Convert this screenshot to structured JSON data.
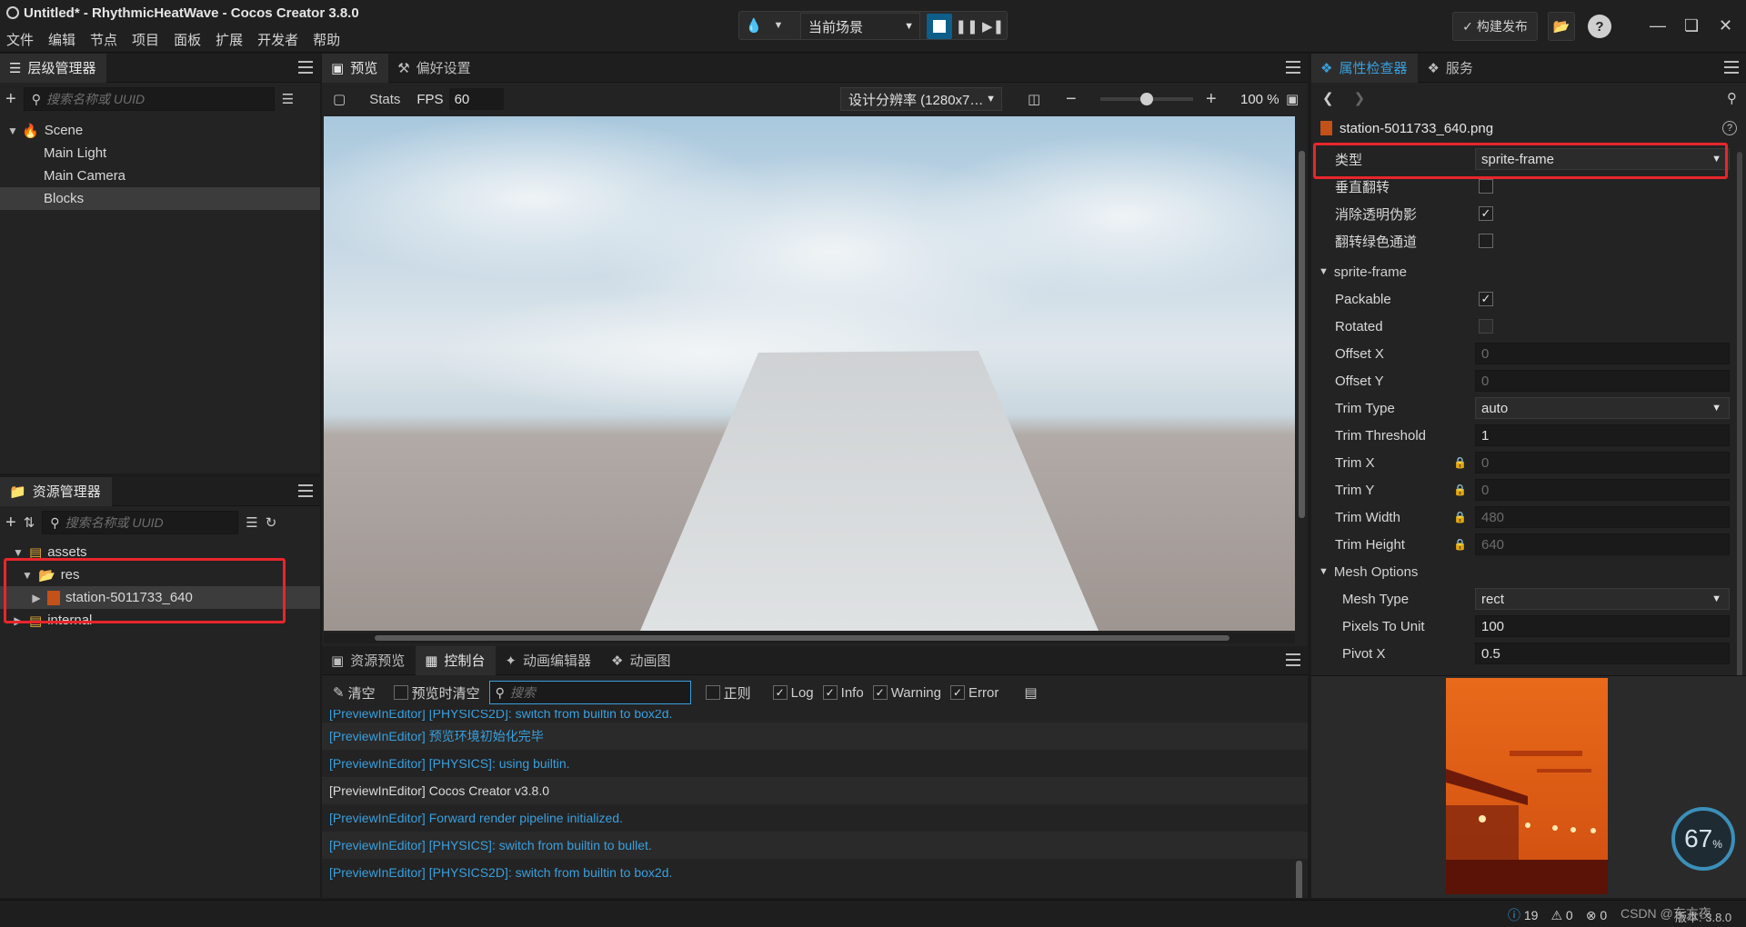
{
  "window": {
    "title": "Untitled* - RhythmicHeatWave - Cocos Creator 3.8.0",
    "menu": [
      "文件",
      "编辑",
      "节点",
      "项目",
      "面板",
      "扩展",
      "开发者",
      "帮助"
    ],
    "scene_select": "当前场景",
    "publish_label": "构建发布"
  },
  "hierarchy": {
    "tab": "层级管理器",
    "search_placeholder": "搜索名称或 UUID",
    "nodes": [
      {
        "label": "Scene"
      },
      {
        "label": "Main Light"
      },
      {
        "label": "Main Camera"
      },
      {
        "label": "Blocks"
      }
    ]
  },
  "assets": {
    "tab": "资源管理器",
    "search_placeholder": "搜索名称或 UUID",
    "items": [
      {
        "label": "assets"
      },
      {
        "label": "res"
      },
      {
        "label": "station-5011733_640"
      },
      {
        "label": "internal"
      }
    ]
  },
  "preview": {
    "tabs": [
      "预览",
      "偏好设置"
    ],
    "stats_label": "Stats",
    "fps_label": "FPS",
    "fps_value": "60",
    "resolution": "设计分辨率 (1280x7…",
    "zoom": "100 %",
    "zoom_level": 0.5
  },
  "console": {
    "tabs": [
      "资源预览",
      "控制台",
      "动画编辑器",
      "动画图"
    ],
    "clear_label": "清空",
    "clear_on_preview": "预览时清空",
    "search_placeholder": "搜索",
    "regex_label": "正则",
    "filters": [
      {
        "label": "Log",
        "checked": true
      },
      {
        "label": "Info",
        "checked": true
      },
      {
        "label": "Warning",
        "checked": true
      },
      {
        "label": "Error",
        "checked": true
      }
    ],
    "logs": [
      {
        "text": "[PreviewInEditor] [PHYSICS2D]: switch from builtin to box2d.",
        "level": "info"
      },
      {
        "text": "[PreviewInEditor] 预览环境初始化完毕",
        "level": "info"
      },
      {
        "text": "[PreviewInEditor] [PHYSICS]: using builtin.",
        "level": "info"
      },
      {
        "text": "[PreviewInEditor] Cocos Creator v3.8.0",
        "level": "log"
      },
      {
        "text": "[PreviewInEditor] Forward render pipeline initialized.",
        "level": "info"
      },
      {
        "text": "[PreviewInEditor] [PHYSICS]: switch from builtin to bullet.",
        "level": "info"
      },
      {
        "text": "[PreviewInEditor] [PHYSICS2D]: switch from builtin to box2d.",
        "level": "info"
      }
    ]
  },
  "inspector": {
    "tabs": [
      "属性检查器",
      "服务"
    ],
    "asset_name": "station-5011733_640.png",
    "type_label": "类型",
    "type_value": "sprite-frame",
    "checks": [
      {
        "label": "垂直翻转",
        "checked": false
      },
      {
        "label": "消除透明伪影",
        "checked": true
      },
      {
        "label": "翻转绿色通道",
        "checked": false
      }
    ],
    "sprite_section": "sprite-frame",
    "packable": {
      "label": "Packable",
      "checked": true
    },
    "rotated": {
      "label": "Rotated",
      "checked": false
    },
    "offset_x": {
      "label": "Offset X",
      "value": "0"
    },
    "offset_y": {
      "label": "Offset Y",
      "value": "0"
    },
    "trim_type": {
      "label": "Trim Type",
      "value": "auto"
    },
    "trim_threshold": {
      "label": "Trim Threshold",
      "value": "1"
    },
    "trim_x": {
      "label": "Trim X",
      "value": "0"
    },
    "trim_y": {
      "label": "Trim Y",
      "value": "0"
    },
    "trim_width": {
      "label": "Trim Width",
      "value": "480"
    },
    "trim_height": {
      "label": "Trim Height",
      "value": "640"
    },
    "mesh_section": "Mesh Options",
    "mesh_type": {
      "label": "Mesh Type",
      "value": "rect"
    },
    "pixels_to_unit": {
      "label": "Pixels To Unit",
      "value": "100"
    },
    "pivot_x": {
      "label": "Pivot X",
      "value": "0.5"
    }
  },
  "status": {
    "info_count": "19",
    "warn_count": "0",
    "error_count": "0",
    "version": "版本: 3.8.0",
    "watermark": "CSDN @东方夜",
    "perf_percent": "67",
    "perf_unit": "%"
  },
  "colors": {
    "accent": "#3a9fdd",
    "highlight": "#e8262b"
  }
}
